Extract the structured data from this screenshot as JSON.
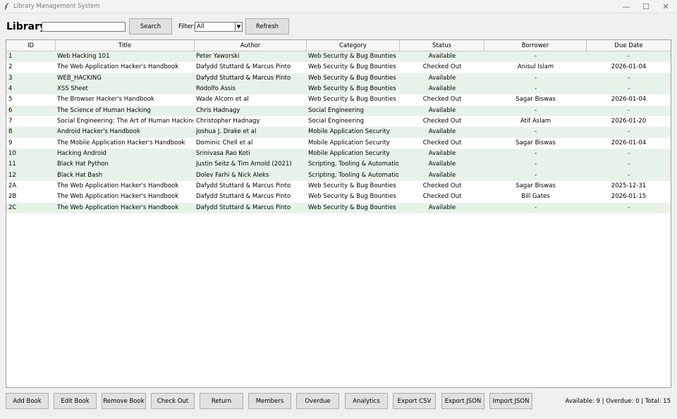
{
  "window": {
    "title": "Library Management System",
    "minimize_glyph": "—",
    "maximize_glyph": "☐",
    "close_glyph": "✕"
  },
  "toolbar": {
    "heading": "Library",
    "search_value": "",
    "search_button": "Search",
    "filter_label": "Filter:",
    "filter_selected": "All",
    "refresh_button": "Refresh"
  },
  "table": {
    "columns": [
      "ID",
      "Title",
      "Author",
      "Category",
      "Status",
      "Borrower",
      "Due Date"
    ],
    "rows": [
      [
        "1",
        "Web Hacking 101",
        "Peter Yaworski",
        "Web Security & Bug Bounties",
        "Available",
        "-",
        "-"
      ],
      [
        "2",
        "The Web Application Hacker's Handbook",
        "Dafydd Stuttard & Marcus Pinto",
        "Web Security & Bug Bounties",
        "Checked Out",
        "Anisul Islam",
        "2026-01-04"
      ],
      [
        "3",
        "WEB_HACKING",
        "Dafydd Stuttard & Marcus Pinto",
        "Web Security & Bug Bounties",
        "Available",
        "-",
        "-"
      ],
      [
        "4",
        "XSS Sheet",
        "Rodolfo Assis",
        "Web Security & Bug Bounties",
        "Available",
        "-",
        "-"
      ],
      [
        "5",
        "The Browser Hacker's Handbook",
        "Wade Alcorn et al",
        "Web Security & Bug Bounties",
        "Checked Out",
        "Sagar Biswas",
        "2026-01-04"
      ],
      [
        "6",
        "The Science of Human Hacking",
        "Chris Hadnagy",
        "Social Engineering",
        "Available",
        "-",
        "-"
      ],
      [
        "7",
        "Social Engineering: The Art of Human Hacking",
        "Christopher Hadnagy",
        "Social Engineering",
        "Checked Out",
        "Atif Aslam",
        "2026-01-20"
      ],
      [
        "8",
        "Android Hacker's Handbook",
        "Joshua J. Drake et al",
        "Mobile Application Security",
        "Available",
        "-",
        "-"
      ],
      [
        "9",
        "The Mobile Application Hacker's Handbook",
        "Dominic Chell et al",
        "Mobile Application Security",
        "Checked Out",
        "Sagar Biswas",
        "2026-01-04"
      ],
      [
        "10",
        "Hacking Android",
        "Srinivasa Rao Koti",
        "Mobile Application Security",
        "Available",
        "-",
        "-"
      ],
      [
        "11",
        "Black Hat Python",
        "Justin Seitz & Tim Arnold (2021)",
        "Scripting, Tooling & Automation",
        "Available",
        "-",
        "-"
      ],
      [
        "12",
        "Black Hat Bash",
        "Dolev Farhi & Nick Aleks",
        "Scripting, Tooling & Automation",
        "Available",
        "-",
        "-"
      ],
      [
        "2A",
        "The Web Application Hacker's Handbook",
        "Dafydd Stuttard & Marcus Pinto",
        "Web Security & Bug Bounties",
        "Checked Out",
        "Sagar Biswas",
        "2025-12-31"
      ],
      [
        "2B",
        "The Web Application Hacker's Handbook",
        "Dafydd Stuttard & Marcus Pinto",
        "Web Security & Bug Bounties",
        "Checked Out",
        "Bill Gates",
        "2026-01-15"
      ],
      [
        "2C",
        "The Web Application Hacker's Handbook",
        "Dafydd Stuttard & Marcus Pinto",
        "Web Security & Bug Bounties",
        "Available",
        "-",
        "-"
      ]
    ]
  },
  "actions": {
    "add_book": "Add Book",
    "edit_book": "Edit Book",
    "remove_book": "Remove Book",
    "check_out": "Check Out",
    "return": "Return",
    "members": "Members",
    "overdue": "Overdue",
    "analytics": "Analytics",
    "export_csv": "Export CSV",
    "export_json": "Export JSON",
    "import_json": "Import JSON"
  },
  "status_bar": {
    "summary": "Available: 9 | Overdue: 0 | Total: 15"
  },
  "colors": {
    "row_alt": "#e7f3e8",
    "row_plain": "#ffffff",
    "button_bg": "#e1e1e1"
  }
}
